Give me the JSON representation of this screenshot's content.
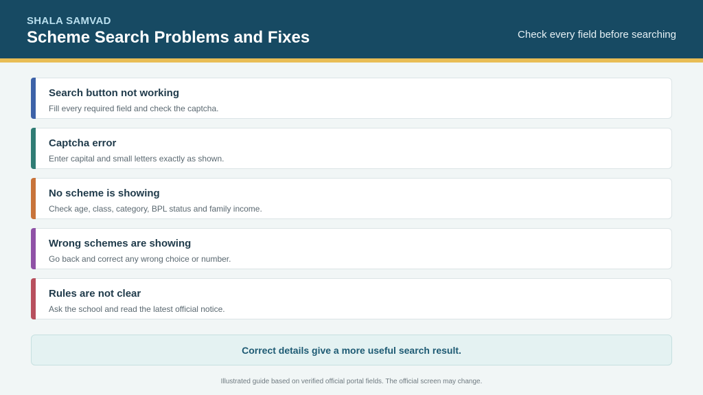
{
  "header": {
    "brand": "SHALA SAMVAD",
    "title": "Scheme Search Problems and Fixes",
    "hint": "Check every field before searching"
  },
  "colors": {
    "header_bg": "#174a63",
    "accent_bar": "#e8bd55"
  },
  "cards": [
    {
      "title": "Search button not working",
      "description": "Fill every required field and check the captcha.",
      "color": "#3d62a8"
    },
    {
      "title": "Captcha error",
      "description": "Enter capital and small letters exactly as shown.",
      "color": "#2f7c74"
    },
    {
      "title": "No scheme is showing",
      "description": "Check age, class, category, BPL status and family income.",
      "color": "#c8733a"
    },
    {
      "title": "Wrong schemes are showing",
      "description": "Go back and correct any wrong choice or number.",
      "color": "#8f52a6"
    },
    {
      "title": "Rules are not clear",
      "description": "Ask the school and read the latest official notice.",
      "color": "#b8505e"
    }
  ],
  "note": "Correct details give a more useful search result.",
  "footer": "Illustrated guide based on verified official portal fields. The official screen may change."
}
